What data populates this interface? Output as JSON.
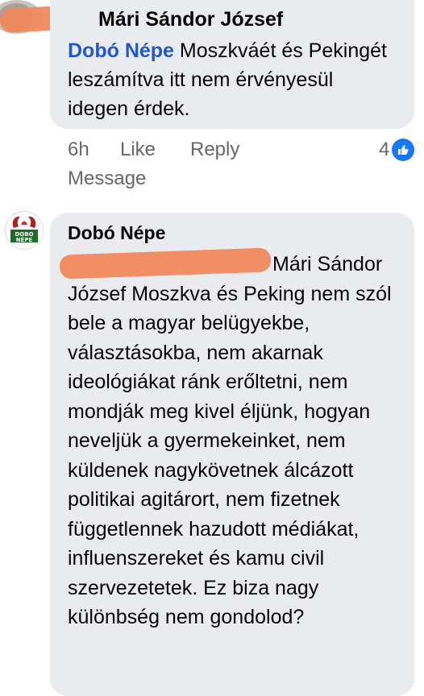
{
  "comment1": {
    "author_name": "Mári Sándor József",
    "mention": "Dobó Népe",
    "text": "Moszkváét és Pekingét leszámítva itt nem érvényesül idegen érdek.",
    "time": "6h",
    "like_label": "Like",
    "reply_label": "Reply",
    "reaction_count": "4",
    "message_label": "Message"
  },
  "comment2": {
    "author_name": "Dobó Népe",
    "avatar_text": "DOBO NÉPE",
    "mention_visible": "Mári Sándor",
    "text": "József Moszkva és Peking nem szól bele a magyar belügyekbe, választásokba, nem akarnak ideológiákat ránk erőltetni, nem mondják meg kivel éljünk, hogyan neveljük a gyermekeinket, nem küldenek nagykövetnek álcázott politikai agitárort, nem fizetnek függetlennek hazudott médiákat, influenszereket és kamu civil szervezetetek. Ez biza nagy különbség nem gondolod?"
  },
  "colors": {
    "bubble": "#e9ebee",
    "mention": "#2258c9",
    "meta": "#65676b",
    "like_blue": "#1877f2",
    "redaction": "#f08a5d"
  }
}
